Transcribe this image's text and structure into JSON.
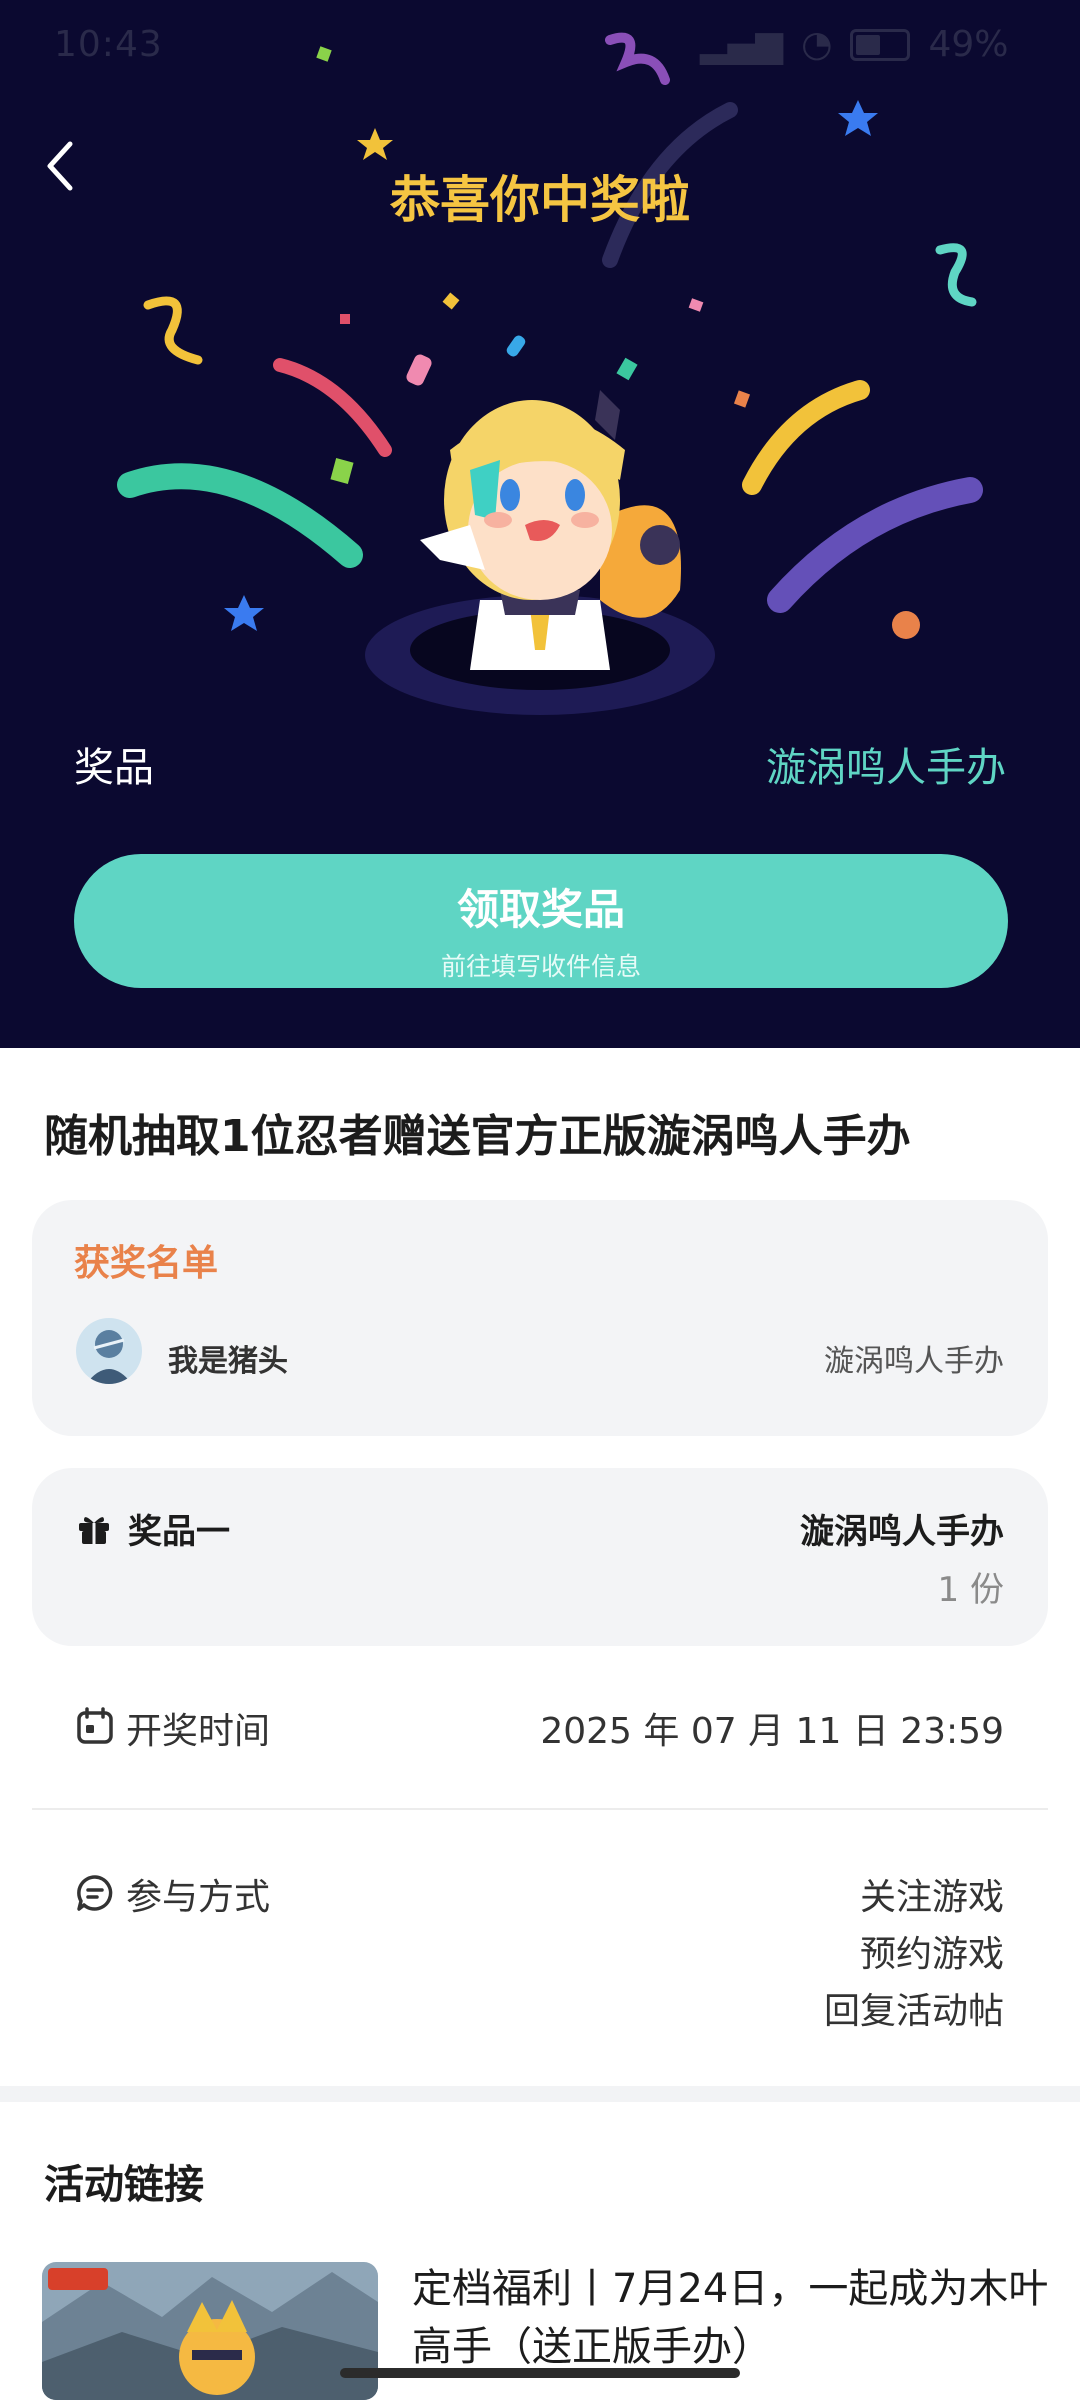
{
  "status_bar": {
    "time": "10:43",
    "battery": "49%"
  },
  "hero": {
    "title": "恭喜你中奖啦",
    "prize_label": "奖品",
    "prize_value": "漩涡鸣人手办",
    "claim_button": {
      "label": "领取奖品",
      "sublabel": "前往填写收件信息"
    }
  },
  "activity": {
    "title": "随机抽取1位忍者赠送官方正版漩涡鸣人手办"
  },
  "winners": {
    "heading": "获奖名单",
    "items": [
      {
        "name": "我是猪头",
        "prize": "漩涡鸣人手办"
      }
    ]
  },
  "prize": {
    "label": "奖品一",
    "name": "漩涡鸣人手办",
    "count": "1 份"
  },
  "draw_time": {
    "label": "开奖时间",
    "value": "2025 年 07 月 11 日 23:59"
  },
  "participation": {
    "label": "参与方式",
    "methods": [
      "关注游戏",
      "预约游戏",
      "回复活动帖"
    ]
  },
  "links": {
    "heading": "活动链接",
    "items": [
      {
        "title": "定档福利丨7月24日，一起成为木叶高手（送正版手办）"
      }
    ]
  },
  "colors": {
    "hero_bg": "#0b0930",
    "title_gold": "#f5c542",
    "accent_teal": "#5fd5c4",
    "winners_orange": "#e9824a"
  }
}
